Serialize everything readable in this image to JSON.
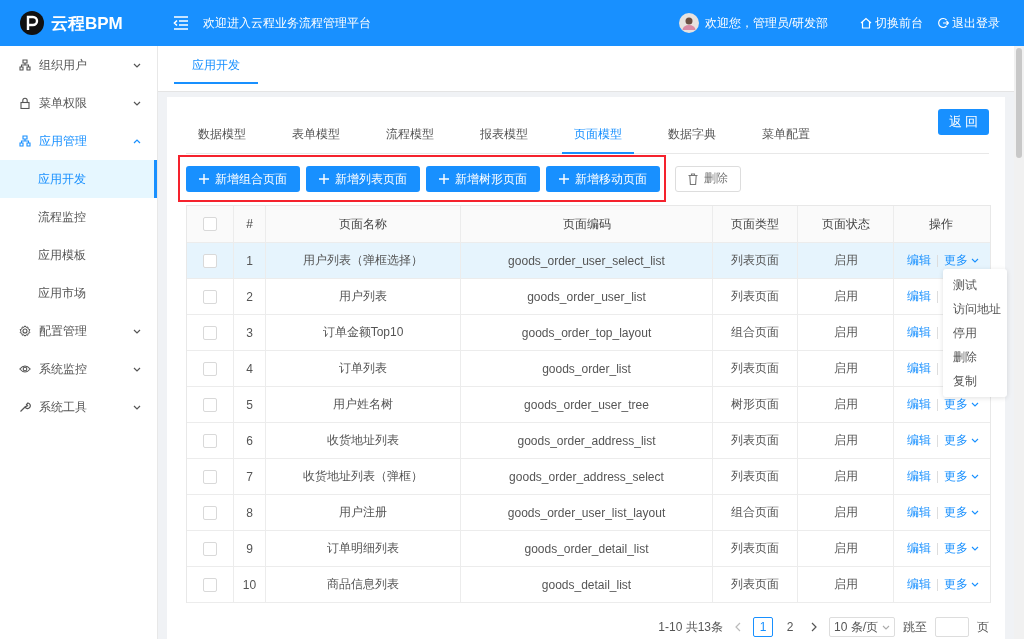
{
  "header": {
    "brand": "云程BPM",
    "welcome": "欢迎进入云程业务流程管理平台",
    "user": "欢迎您，管理员/研发部",
    "links": [
      "切换前台",
      "退出登录"
    ]
  },
  "sidebar": {
    "items": [
      {
        "label": "组织用户",
        "expanded": false,
        "selected": false
      },
      {
        "label": "菜单权限",
        "expanded": false,
        "selected": false
      },
      {
        "label": "应用管理",
        "expanded": true,
        "selected": false,
        "children": [
          {
            "label": "应用开发",
            "selected": true
          },
          {
            "label": "流程监控",
            "selected": false
          },
          {
            "label": "应用模板",
            "selected": false
          },
          {
            "label": "应用市场",
            "selected": false
          }
        ]
      },
      {
        "label": "配置管理",
        "expanded": false,
        "selected": false
      },
      {
        "label": "系统监控",
        "expanded": false,
        "selected": false
      },
      {
        "label": "系统工具",
        "expanded": false,
        "selected": false
      }
    ]
  },
  "page_tabs": [
    {
      "label": "应用开发",
      "selected": true
    }
  ],
  "model_tabs": [
    {
      "label": "数据模型",
      "selected": false
    },
    {
      "label": "表单模型",
      "selected": false
    },
    {
      "label": "流程模型",
      "selected": false
    },
    {
      "label": "报表模型",
      "selected": false
    },
    {
      "label": "页面模型",
      "selected": true
    },
    {
      "label": "数据字典",
      "selected": false
    },
    {
      "label": "菜单配置",
      "selected": false
    }
  ],
  "back_button": "返 回",
  "toolbar": [
    {
      "label": "新增组合页面",
      "kind": "add"
    },
    {
      "label": "新增列表页面",
      "kind": "add"
    },
    {
      "label": "新增树形页面",
      "kind": "add"
    },
    {
      "label": "新增移动页面",
      "kind": "add"
    },
    {
      "label": "删除",
      "kind": "delete"
    }
  ],
  "table": {
    "header_checked": false,
    "columns": [
      "#",
      "页面名称",
      "页面编码",
      "页面类型",
      "页面状态",
      "操作"
    ],
    "rows": [
      {
        "checked": false,
        "highlighted": true,
        "cells": [
          "1",
          "用户列表（弹框选择）",
          "goods_order_user_select_list",
          "列表页面",
          "启用"
        ],
        "actions": [
          "编辑",
          "更多"
        ]
      },
      {
        "checked": false,
        "highlighted": false,
        "cells": [
          "2",
          "用户列表",
          "goods_order_user_list",
          "列表页面",
          "启用"
        ],
        "actions": [
          "编辑"
        ]
      },
      {
        "checked": false,
        "highlighted": false,
        "cells": [
          "3",
          "订单金额Top10",
          "goods_order_top_layout",
          "组合页面",
          "启用"
        ],
        "actions": [
          "编辑"
        ]
      },
      {
        "checked": false,
        "highlighted": false,
        "cells": [
          "4",
          "订单列表",
          "goods_order_list",
          "列表页面",
          "启用"
        ],
        "actions": [
          "编辑"
        ]
      },
      {
        "checked": false,
        "highlighted": false,
        "cells": [
          "5",
          "用户姓名树",
          "goods_order_user_tree",
          "树形页面",
          "启用"
        ],
        "actions": [
          "编辑",
          "更多"
        ]
      },
      {
        "checked": false,
        "highlighted": false,
        "cells": [
          "6",
          "收货地址列表",
          "goods_order_address_list",
          "列表页面",
          "启用"
        ],
        "actions": [
          "编辑",
          "更多"
        ]
      },
      {
        "checked": false,
        "highlighted": false,
        "cells": [
          "7",
          "收货地址列表（弹框）",
          "goods_order_address_select",
          "列表页面",
          "启用"
        ],
        "actions": [
          "编辑",
          "更多"
        ]
      },
      {
        "checked": false,
        "highlighted": false,
        "cells": [
          "8",
          "用户注册",
          "goods_order_user_list_layout",
          "组合页面",
          "启用"
        ],
        "actions": [
          "编辑",
          "更多"
        ]
      },
      {
        "checked": false,
        "highlighted": false,
        "cells": [
          "9",
          "订单明细列表",
          "goods_order_detail_list",
          "列表页面",
          "启用"
        ],
        "actions": [
          "编辑",
          "更多"
        ]
      },
      {
        "checked": false,
        "highlighted": false,
        "cells": [
          "10",
          "商品信息列表",
          "goods_detail_list",
          "列表页面",
          "启用"
        ],
        "actions": [
          "编辑",
          "更多"
        ]
      }
    ]
  },
  "dropdown": {
    "items": [
      "测试",
      "访问地址",
      "停用",
      "删除",
      "复制"
    ]
  },
  "pagination": {
    "total": "1-10 共13条",
    "pages": [
      {
        "label": "1",
        "selected": true
      },
      {
        "label": "2",
        "selected": false
      }
    ],
    "page_size": "10 条/页",
    "jump_label": "跳至",
    "jump_suffix": "页"
  }
}
